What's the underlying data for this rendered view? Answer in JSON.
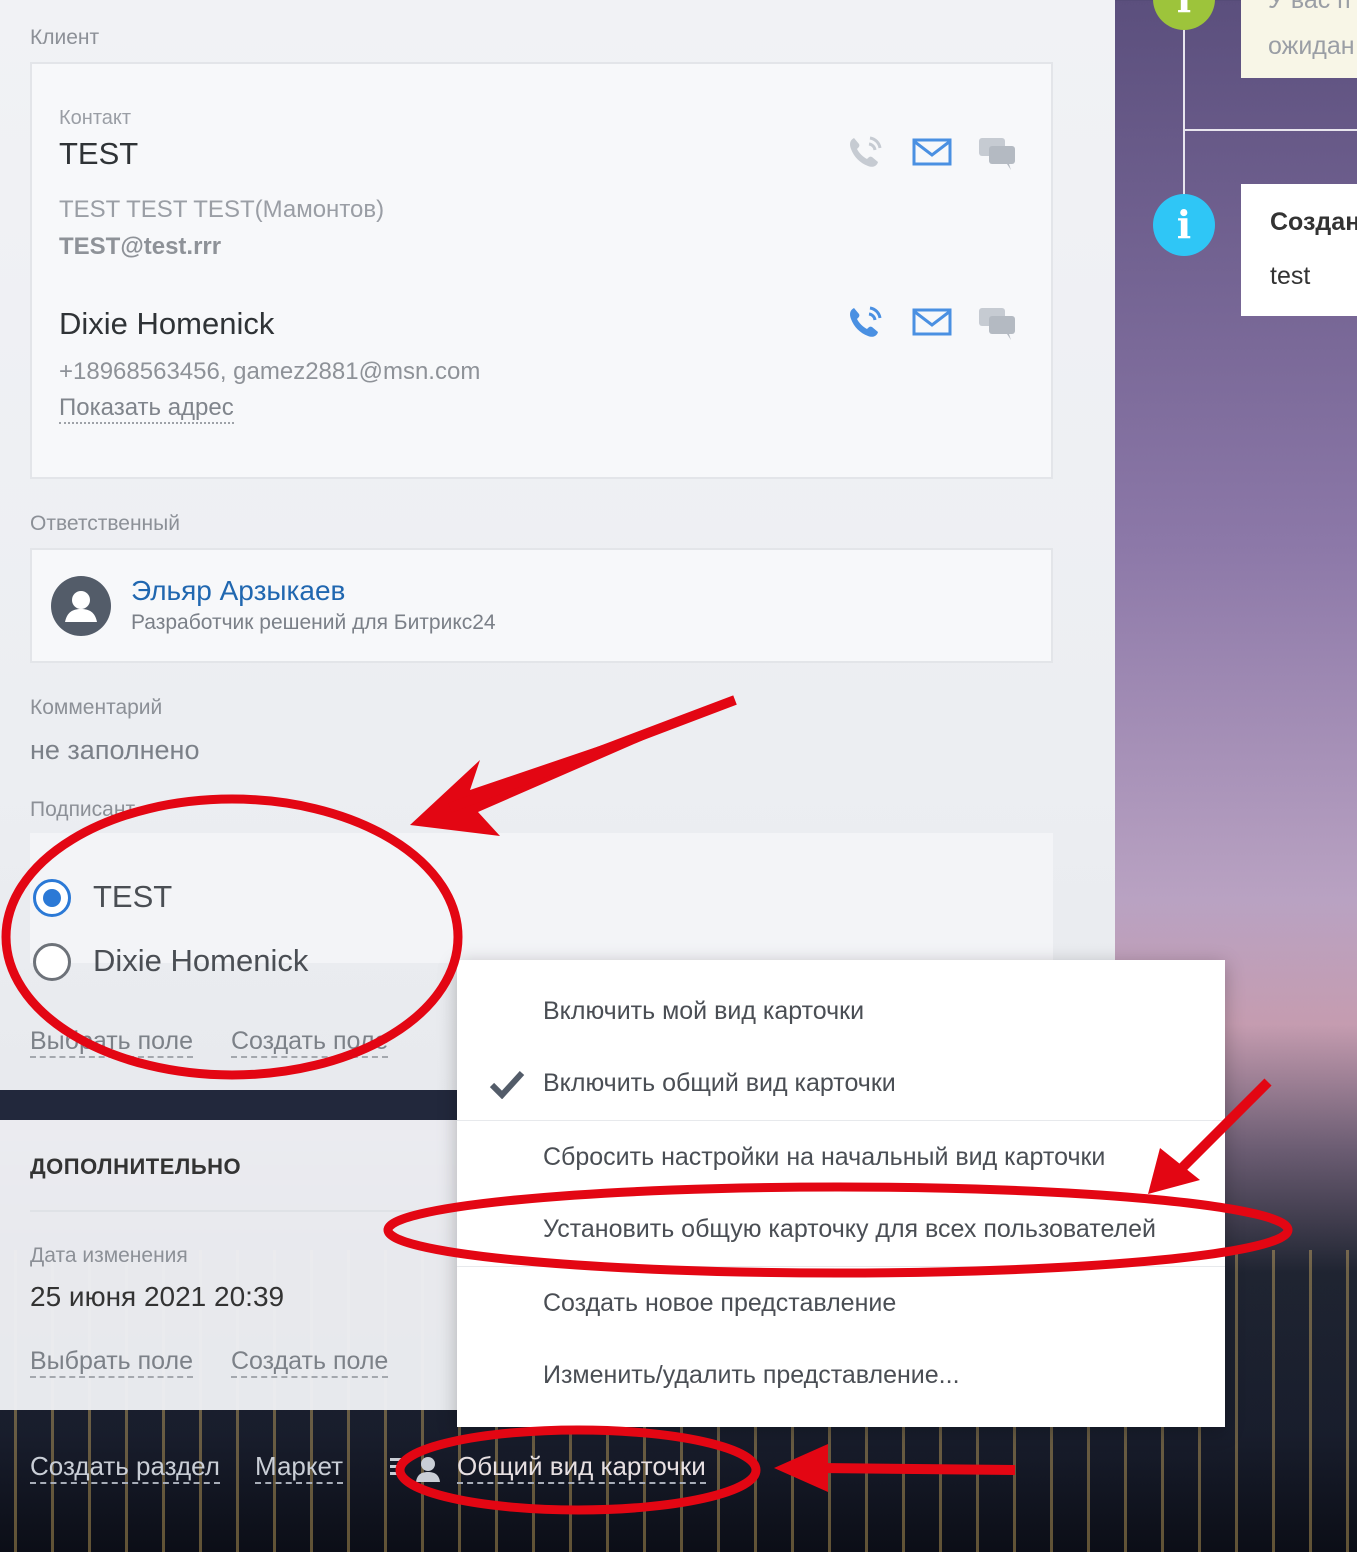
{
  "client": {
    "section_label": "Клиент",
    "contact_label": "Контакт",
    "contacts": [
      {
        "name": "TEST",
        "line1": "TEST TEST TEST(Мамонтов)",
        "line2": "TEST@test.rrr"
      },
      {
        "name": "Dixie Homenick",
        "line1": "+18968563456, gamez2881@msn.com",
        "address_link": "Показать адрес"
      }
    ]
  },
  "responsible": {
    "section_label": "Ответственный",
    "name": "Эльяр Арзыкаев",
    "role": "Разработчик решений для Битрикс24"
  },
  "comment": {
    "label": "Комментарий",
    "value": "не заполнено"
  },
  "signatory": {
    "label": "Подписант",
    "options": [
      {
        "label": "TEST",
        "checked": true
      },
      {
        "label": "Dixie Homenick",
        "checked": false
      }
    ]
  },
  "field_links": {
    "select_field": "Выбрать поле",
    "create_field": "Создать поле"
  },
  "additional": {
    "heading": "ДОПОЛНИТЕЛЬНО",
    "date_label": "Дата изменения",
    "date_value": "25 июня 2021 20:39"
  },
  "timeline": {
    "top_text_1": "У вас п",
    "top_text_2": "ожидан",
    "card_title": "Создан",
    "card_text": "test",
    "colors": {
      "green": "#9dc43b",
      "blue": "#2fc6f6"
    }
  },
  "menu": {
    "items": [
      {
        "label": "Включить мой вид карточки",
        "checked": false
      },
      {
        "label": "Включить общий вид карточки",
        "checked": true
      },
      {
        "label": "Сбросить настройки на начальный вид карточки",
        "checked": false
      },
      {
        "label": "Установить общую карточку для всех пользователей",
        "checked": false
      },
      {
        "label": "Создать новое представление",
        "checked": false
      },
      {
        "label": "Изменить/удалить представление...",
        "checked": false
      }
    ]
  },
  "footer": {
    "create_section": "Создать раздел",
    "market": "Маркет",
    "common_view": "Общий вид карточки"
  },
  "colors": {
    "accent_blue": "#2067b0",
    "radio_blue": "#2b79d6",
    "annotation_red": "#e30613"
  }
}
